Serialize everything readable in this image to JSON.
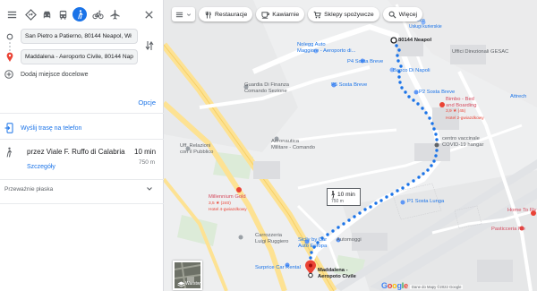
{
  "panel": {
    "travel_modes": [
      "best",
      "driving",
      "transit",
      "walking",
      "cycling",
      "flights"
    ],
    "active_mode": "walking",
    "origin_value": "San Pietro a Patierno, 80144 Neapol, Wł",
    "destination_value": "Maddalena - Aeroporto Civile, 80144 Nap",
    "add_destination": "Dodaj miejsce docelowe",
    "options": "Opcje",
    "send_to_phone": "Wyślij trasę na telefon",
    "route": {
      "title": "przez Viale F. Ruffo di Calabria",
      "time": "10 min",
      "distance": "750 m",
      "details": "Szczegóły"
    },
    "mostly_flat": "Przeważnie płaska"
  },
  "map": {
    "chips": {
      "restaurants": "Restauracje",
      "cafes": "Kawiarnie",
      "grocery": "Sklepy spożywcze",
      "more": "Więcej"
    },
    "pois": {
      "unisco": "Unisco",
      "unisco_sub": "Usługi kurierskie",
      "start_label": "80144 Neapol",
      "nolegg": "Nolegg Auto",
      "nolegg2": "Maggiore - Aeroporto di...",
      "p4": "P4 Sosta Breve",
      "uffici": "Uffici Direzionali GESAC",
      "banco": "Banco Di Napoli",
      "p5": "P5 Sosta Breve",
      "guardia": "Guardia Di Finanza",
      "guardia2": "Comando Sezione",
      "p2": "P2 Sosta Breve",
      "bimbo": "Bimbo - Bed",
      "bimbo2": "and Boarding",
      "bimbo_rating": "3,9 ★ (45)",
      "bimbo_type": "Hotel 2-gwiazdkowy",
      "attrech": "Attrech",
      "aeronautica": "Aeronautica",
      "aeronautica2": "Militare - Comando",
      "centro": "centro vaccinale",
      "centro2": "COVID-19 hangar",
      "uff_relazioni": "Uff. Relazioni",
      "uff_relazioni2": "con il Pubblico",
      "millennium": "Millennium Gold",
      "millennium_rating": "3,5 ★ (240)",
      "millennium_type": "Hotel 4-gwiazdkowy",
      "p1": "P1 Sosta Lunga",
      "hometo": "Home To Fly",
      "rugge": "Ruggiero",
      "carrozzeria": "Carrozzeria",
      "carrozzeria2": "Luigi Ruggiero",
      "sicily": "Sicily by Car",
      "sicily2": "Auto Europa",
      "automoggi": "Automoggi",
      "pasticceria": "Pasticceria Me",
      "surprice": "Surprice Car Rental",
      "destination": "Maddalena -",
      "destination2": "Aeropoto Civile"
    },
    "walk_time": "10 min",
    "walk_dist": "750 m",
    "satellite_label": "Warstwy",
    "google": "Google",
    "attribution": "Dane do Mapy ©2022 Google"
  },
  "colors": {
    "accent": "#1a73e8",
    "route_dot": "#1a73e8",
    "destination_pin": "#ea4335"
  }
}
